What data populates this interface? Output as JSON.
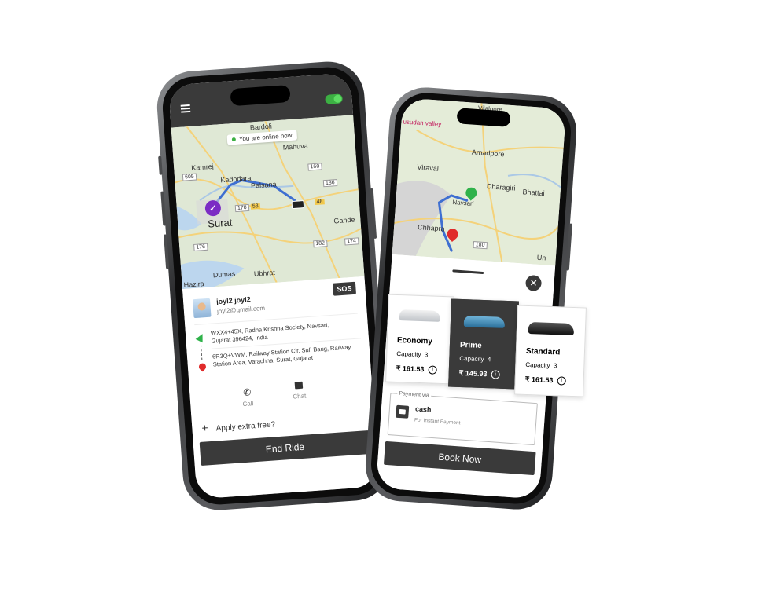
{
  "phone1": {
    "online_status": "You are online now",
    "map_labels": {
      "bardoli": "Bardoli",
      "mahuva": "Mahuva",
      "kamrej": "Kamrej",
      "kadodara": "Kadodara",
      "palsana": "Palsana",
      "surat": "Surat",
      "gandevi": "Gande",
      "dumas": "Dumas",
      "ubhrat": "Ubhrat",
      "hazira": "Hazira",
      "hw_605": "605",
      "hw_160": "160",
      "hw_170": "170",
      "hw_53": "53",
      "hw_48": "48",
      "hw_182": "182",
      "hw_174": "174",
      "hw_176": "176",
      "hw_186": "186"
    },
    "sos_label": "SOS",
    "driver_name": "joyl2 joyl2",
    "driver_email": "joyl2@gmail.com",
    "pickup_address": "WXX4+45X, Radha Krishna Society, Navsari, Gujarat 396424, India",
    "drop_address": "6R3Q+VWM, Railway Station Cir, Sufi Baug, Railway Station Area, Varachha, Surat, Gujarat",
    "call_label": "Call",
    "chat_label": "Chat",
    "extra_fee_label": "Apply extra free?",
    "end_ride_label": "End Ride"
  },
  "phone2": {
    "map_labels": {
      "top": "Vijalpore",
      "valley": "usudan valley",
      "amadpore": "Amadpore",
      "viraval": "Viraval",
      "dharagiri": "Dharagiri",
      "bhattai": "Bhattai",
      "navsari": "Navsari",
      "chhapra": "Chhapra",
      "un": "Un",
      "hw_180": "180"
    },
    "vehicles": [
      {
        "name": "Economy",
        "capacity_label": "Capacity",
        "capacity": "3",
        "price": "₹ 161.53"
      },
      {
        "name": "Prime",
        "capacity_label": "Capacity",
        "capacity": "4",
        "price": "₹ 145.93"
      },
      {
        "name": "Standard",
        "capacity_label": "Capacity",
        "capacity": "3",
        "price": "₹ 161.53"
      }
    ],
    "payment_via_label": "Payment via",
    "payment_method": "cash",
    "payment_sub": "For Instant Payment",
    "book_now_label": "Book Now"
  },
  "colors": {
    "header_dark": "#3a3a3a",
    "toggle_green": "#3cb043",
    "route_blue": "#3f6fd1",
    "pin_green": "#2fb24a",
    "pin_red": "#e02b2b",
    "check_purple": "#7b2cc4"
  }
}
